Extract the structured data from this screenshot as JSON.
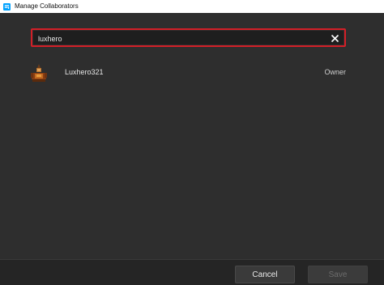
{
  "window": {
    "title": "Manage Collaborators",
    "icon": "roblox-studio-icon"
  },
  "search": {
    "value": "luxhero",
    "clear_icon": "close-icon",
    "highlight_color": "#d31f27"
  },
  "collaborators": [
    {
      "name": "Luxhero321",
      "role": "Owner",
      "avatar": "avatar"
    }
  ],
  "footer": {
    "cancel_label": "Cancel",
    "save_label": "Save",
    "save_enabled": false
  }
}
